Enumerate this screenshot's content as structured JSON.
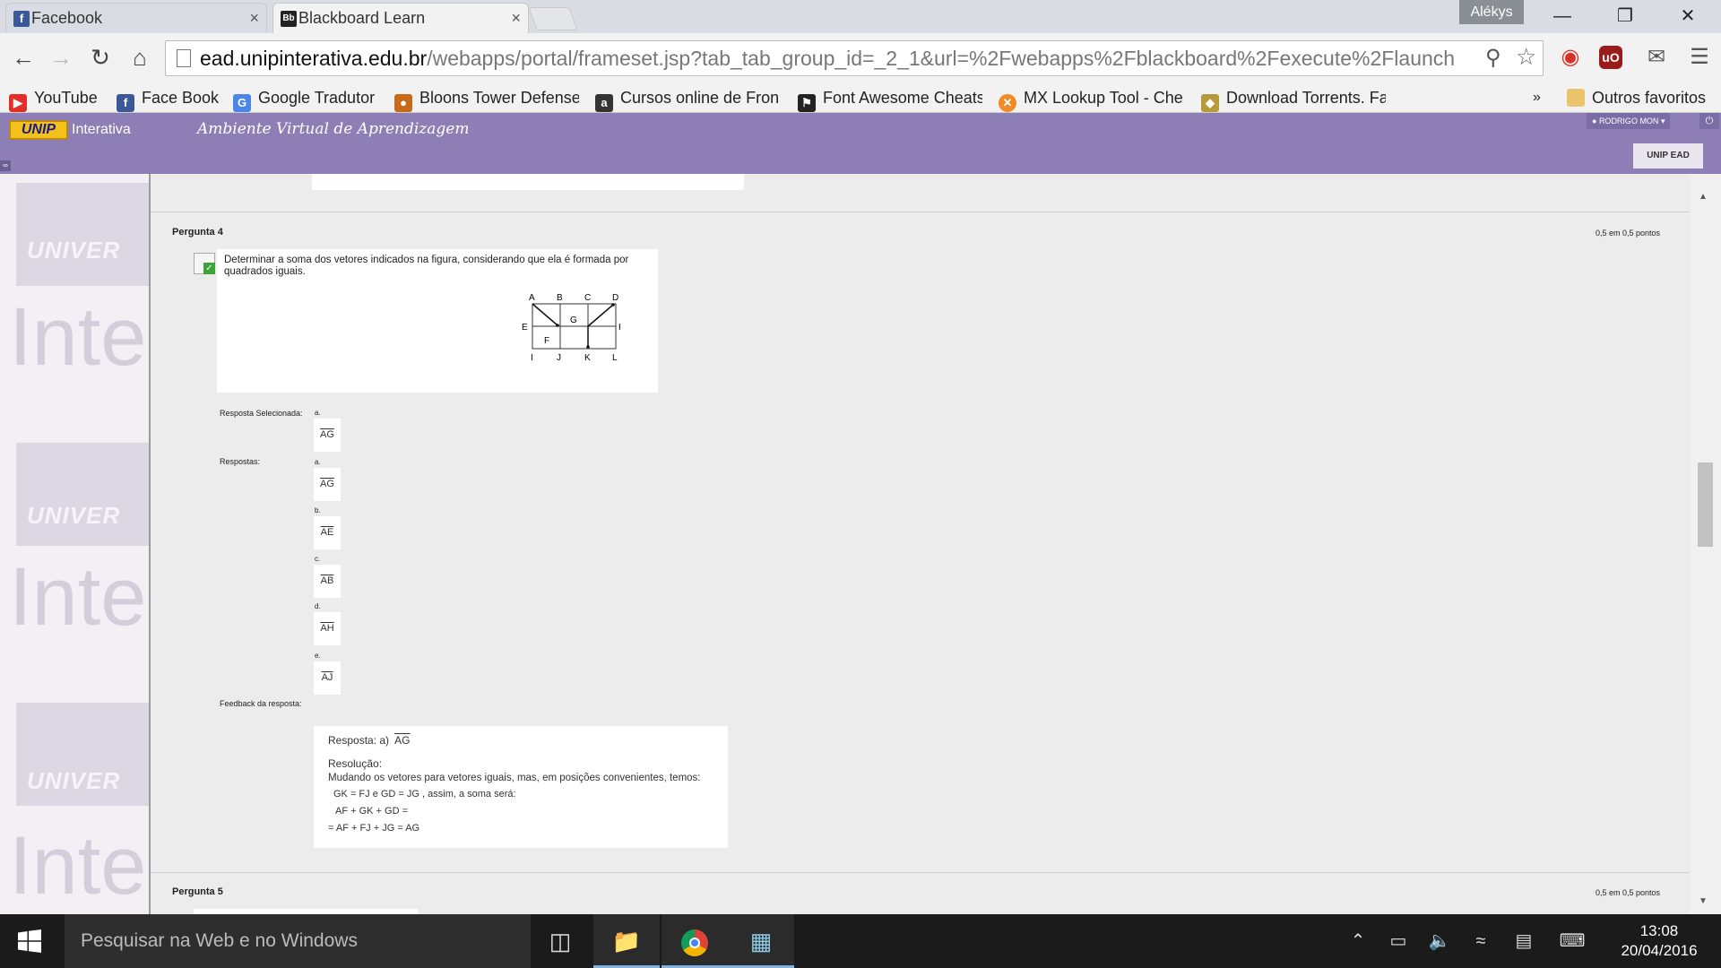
{
  "browser": {
    "tabs": [
      {
        "title": "Facebook",
        "icon": "facebook-icon"
      },
      {
        "title": "Blackboard Learn",
        "icon": "blackboard-icon"
      }
    ],
    "profile_name": "Alékys",
    "url_domain": "ead.unipinterativa.edu.br",
    "url_path": "/webapps/portal/frameset.jsp?tab_tab_group_id=_2_1&url=%2Fwebapps%2Fblackboard%2Fexecute%2Flaunch",
    "bookmarks": [
      "YouTube",
      "Face Book",
      "Google Tradutor",
      "Bloons Tower Defense",
      "Cursos online de Fron",
      "Font Awesome Cheats",
      "MX Lookup Tool - Che",
      "Download Torrents. Fa"
    ],
    "bookmarks_overflow": "»",
    "other_bookmarks": "Outros favoritos"
  },
  "header": {
    "logo_text": "UNIP",
    "brand": "Interativa",
    "subtitle": "Ambiente Virtual de Aprendizagem",
    "user": "RODRIGO MON",
    "tab_button": "UNIP EAD"
  },
  "sidebar": {
    "watermark_univ": "UNIVER",
    "watermark_inte": "Inte"
  },
  "question4": {
    "title": "Pergunta 4",
    "points": "0,5 em 0,5 pontos",
    "prompt": "Determinar a soma dos vetores indicados na figura, considerando que ela é formada por quadrados iguais.",
    "figure_labels": {
      "top": [
        "A",
        "B",
        "C",
        "D"
      ],
      "bottom": [
        "I",
        "J",
        "K",
        "L"
      ],
      "left": "E",
      "right": "H",
      "center": "G",
      "lower": "F"
    },
    "selected_label": "Resposta Selecionada:",
    "selected_letter": "a.",
    "selected_value": "AG",
    "answers_label": "Respostas:",
    "answers": [
      {
        "letter": "a.",
        "value": "AG"
      },
      {
        "letter": "b.",
        "value": "AE"
      },
      {
        "letter": "c.",
        "value": "AB"
      },
      {
        "letter": "d.",
        "value": "AH"
      },
      {
        "letter": "e.",
        "value": "AJ"
      }
    ],
    "feedback_label": "Feedback da resposta:",
    "feedback": {
      "line1_prefix": "Resposta: a)",
      "line1_vec": "AG",
      "line2": "Resolução:",
      "line3": "Mudando os vetores para vetores iguais, mas, em posições convenientes, temos:",
      "line4": "GK = FJ   e  GD = JG , assim, a soma será:",
      "line5": "AF + GK  + GD =",
      "line6": "= AF + FJ + JG = AG"
    }
  },
  "question5": {
    "title": "Pergunta 5",
    "points": "0,5 em 0,5 pontos"
  },
  "taskbar": {
    "search_placeholder": "Pesquisar na Web e no Windows",
    "time": "13:08",
    "date": "20/04/2016"
  }
}
